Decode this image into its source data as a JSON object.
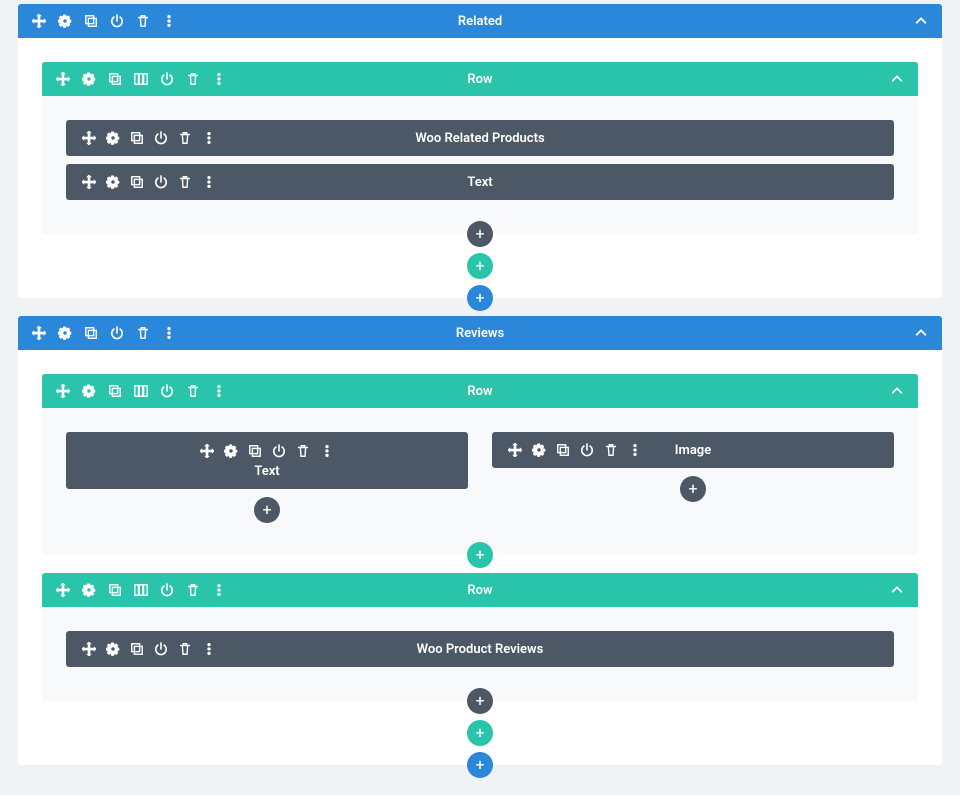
{
  "sections": [
    {
      "title": "Related",
      "rows": [
        {
          "title": "Row",
          "layout": "single",
          "modules": [
            {
              "title": "Woo Related Products"
            },
            {
              "title": "Text"
            }
          ]
        }
      ]
    },
    {
      "title": "Reviews",
      "rows": [
        {
          "title": "Row",
          "layout": "two-col",
          "columns": [
            {
              "modules": [
                {
                  "title": "Text",
                  "stacked": true
                }
              ]
            },
            {
              "modules": [
                {
                  "title": "Image"
                }
              ]
            }
          ]
        },
        {
          "title": "Row",
          "layout": "single",
          "modules": [
            {
              "title": "Woo Product Reviews"
            }
          ]
        }
      ]
    }
  ],
  "icons": {
    "move": "move-icon",
    "settings": "gear-icon",
    "duplicate": "duplicate-icon",
    "columns": "columns-icon",
    "power": "power-icon",
    "delete": "trash-icon",
    "more": "more-icon",
    "collapse": "chevron-up-icon",
    "add": "plus-icon"
  }
}
